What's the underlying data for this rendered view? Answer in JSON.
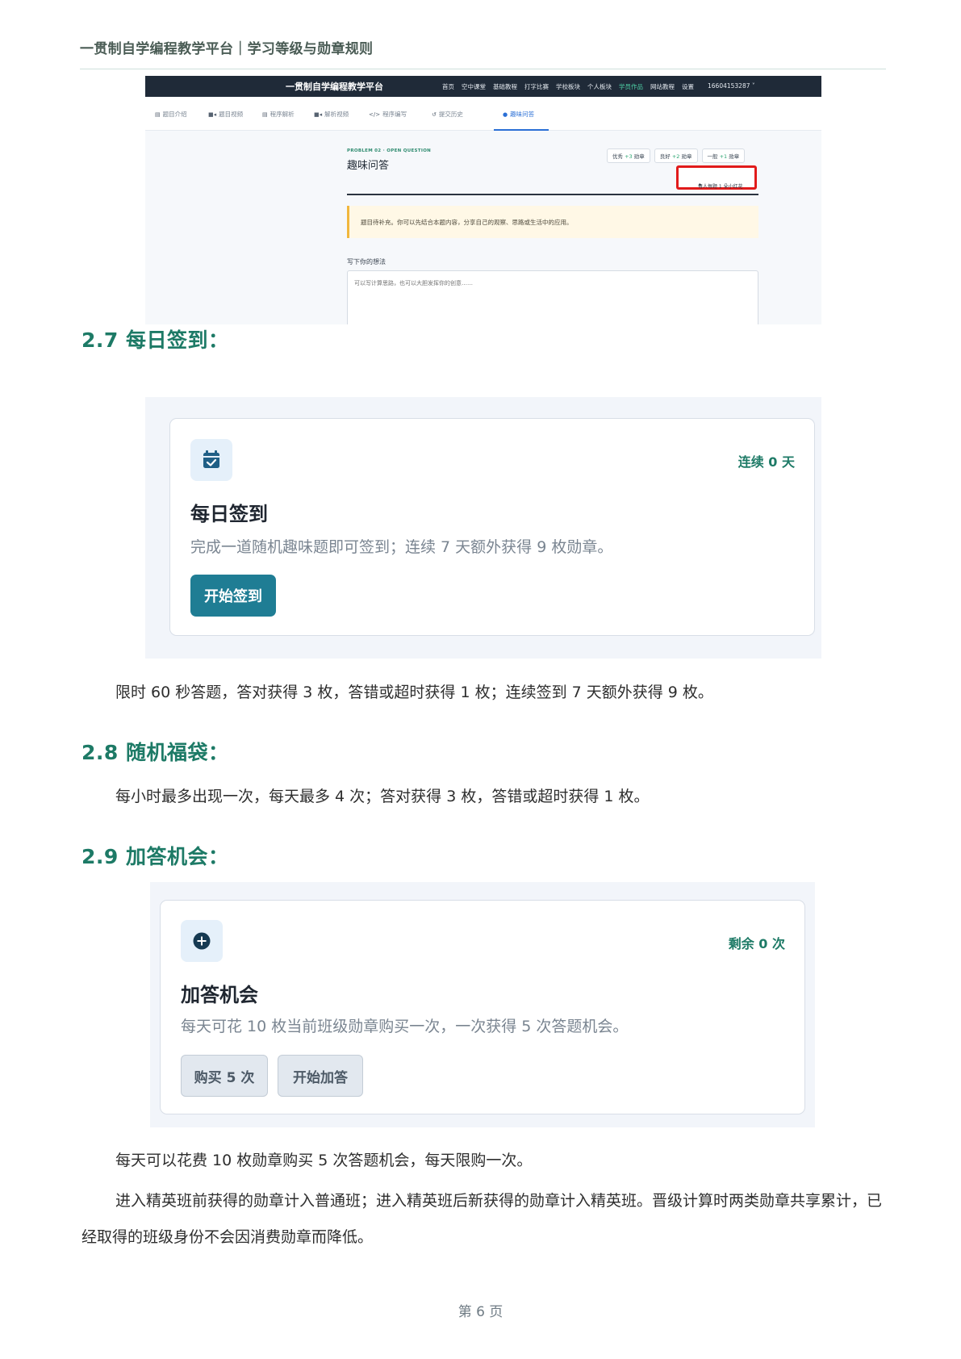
{
  "document": {
    "running_header": "一贯制自学编程教学平台｜学习等级与勋章规则",
    "page_footer": "第 6 页"
  },
  "screenshot_problem": {
    "brand": "一贯制自学编程教学平台",
    "nav": [
      "首页",
      "空中课堂",
      "基础教程",
      "打字比赛",
      "学校板块",
      "个人板块",
      "学员作品",
      "网站教程",
      "设置"
    ],
    "nav_active": "学员作品",
    "user": "16604153287 ˅",
    "tabs": [
      "题目介绍",
      "题目视频",
      "程序解析",
      "解析视频",
      "程序编写",
      "提交历史",
      "趣味问答"
    ],
    "tab_active": "趣味问答",
    "kicker": "PROBLEM 02 · OPEN QUESTION",
    "question_title": "趣味问答",
    "grades": [
      {
        "label": "优秀",
        "reward": "+3",
        "unit": "勋章"
      },
      {
        "label": "良好",
        "reward": "+2",
        "unit": "勋章"
      },
      {
        "label": "一般",
        "reward": "+1",
        "unit": "勋章"
      }
    ],
    "limit_note": "每人每题 1 朵小红花",
    "notice": "题目待补充。你可以先结合本题内容，分享自己的观察、思路或生活中的应用。",
    "answer_label": "写下你的想法",
    "answer_placeholder": "可以写计算思路，也可以大胆发挥你的创意……"
  },
  "section_27": {
    "heading": "2.7 每日签到：",
    "card": {
      "icon": "calendar-check-icon",
      "counter": "连续 0 天",
      "title": "每日签到",
      "desc": "完成一道随机趣味题即可签到；连续 7 天额外获得 9 枚勋章。",
      "button": "开始签到"
    },
    "paragraph": "限时 60 秒答题，答对获得 3 枚，答错或超时获得 1 枚；连续签到 7 天额外获得 9 枚。"
  },
  "section_28": {
    "heading": "2.8 随机福袋：",
    "paragraph": "每小时最多出现一次，每天最多 4 次；答对获得 3 枚，答错或超时获得 1 枚。"
  },
  "section_29": {
    "heading": "2.9 加答机会：",
    "card": {
      "icon": "plus-circle-icon",
      "counter": "剩余 0 次",
      "title": "加答机会",
      "desc": "每天可花 10 枚当前班级勋章购买一次，一次获得 5 次答题机会。",
      "buy_button": "购买 5 次",
      "start_button": "开始加答"
    },
    "paragraph1": "每天可以花费 10 枚勋章购买 5 次答题机会，每天限购一次。",
    "paragraph2": "进入精英班前获得的勋章计入普通班；进入精英班后新获得的勋章计入精英班。晋级计算时两类勋章共享累计，已经取得的班级身份不会因消费勋章而降低。"
  },
  "colors": {
    "heading": "#1d7a66",
    "primary_button": "#1f7d94",
    "highlight_box": "#e11b1b"
  }
}
